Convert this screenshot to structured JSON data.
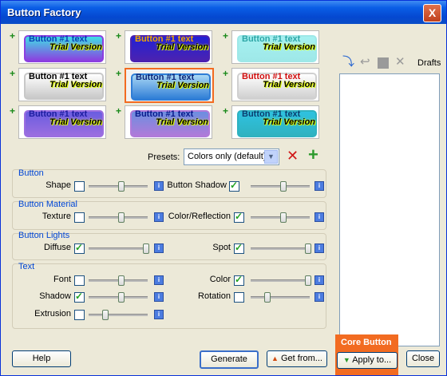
{
  "window": {
    "title": "Button Factory",
    "close_label": "X"
  },
  "thumbnails": [
    {
      "text1": "Button #1 text",
      "text2": "Trial Version",
      "bg": "#3fdfe5",
      "border": "#8c3fe0",
      "text1_color": "#0b3db5"
    },
    {
      "text1": "Button #1 text",
      "text2": "Trial Version",
      "bg": "#2121d6",
      "border": "#4b22b0",
      "text1_color": "#f0a500"
    },
    {
      "text1": "Button #1 text",
      "text2": "Trial Version",
      "bg": "#a6f1f1",
      "border": "#9ee8e8",
      "text1_color": "#2ea6a6"
    },
    {
      "text1": "Button #1 text",
      "text2": "Trial Version",
      "bg": "#ffffff",
      "border": "#c8c8c8",
      "text1_color": "#000000"
    },
    {
      "text1": "Button #1 text",
      "text2": "Trial Version",
      "bg": "#a9d8f5",
      "border": "#2f7dd6",
      "text1_color": "#10277a"
    },
    {
      "text1": "Button #1 text",
      "text2": "Trial Version",
      "bg": "#ffffff",
      "border": "#d0d0d0",
      "text1_color": "#d21010"
    },
    {
      "text1": "Button #1 text",
      "text2": "Trial Version",
      "bg": "#6a5de0",
      "border": "#9b6ee0",
      "text1_color": "#1e1ea0"
    },
    {
      "text1": "Button #1 text",
      "text2": "Trial Version",
      "bg": "#6c8fe0",
      "border": "#b07ad9",
      "text1_color": "#0a1a8c"
    },
    {
      "text1": "Button #1 text",
      "text2": "Trial Version",
      "bg": "#2fc2e0",
      "border": "#2fb2c0",
      "text1_color": "#0b3e6e"
    }
  ],
  "presets": {
    "label": "Presets:",
    "value": "Colors only (default)"
  },
  "sections": {
    "button": "Button",
    "material": "Button Material",
    "lights": "Button Lights",
    "text": "Text"
  },
  "options": {
    "shape": {
      "label": "Shape",
      "checked": false,
      "slider": 0.55
    },
    "button_shadow": {
      "label": "Button Shadow",
      "checked": true,
      "slider": 0.55
    },
    "texture": {
      "label": "Texture",
      "checked": false,
      "slider": 0.55
    },
    "color_reflection": {
      "label": "Color/Reflection",
      "checked": true,
      "slider": 0.55
    },
    "diffuse": {
      "label": "Diffuse",
      "checked": true,
      "slider": 1.0
    },
    "spot": {
      "label": "Spot",
      "checked": true,
      "slider": 1.0
    },
    "font": {
      "label": "Font",
      "checked": false,
      "slider": 0.55
    },
    "color": {
      "label": "Color",
      "checked": true,
      "slider": 1.0
    },
    "shadow": {
      "label": "Shadow",
      "checked": true,
      "slider": 0.55
    },
    "rotation": {
      "label": "Rotation",
      "checked": false,
      "slider": 0.25
    },
    "extrusion": {
      "label": "Extrusion",
      "checked": false,
      "slider": 0.25
    }
  },
  "drafts": {
    "label": "Drafts"
  },
  "footer": {
    "help": "Help",
    "generate": "Generate",
    "get_from": "Get from...",
    "core_button": "Core Button",
    "apply_to": "Apply to...",
    "close": "Close"
  },
  "colors": {
    "titlebar": "#0a5ee6",
    "accent_orange": "#f26b21",
    "section_title": "#0046d5",
    "check_green": "#21a121"
  }
}
